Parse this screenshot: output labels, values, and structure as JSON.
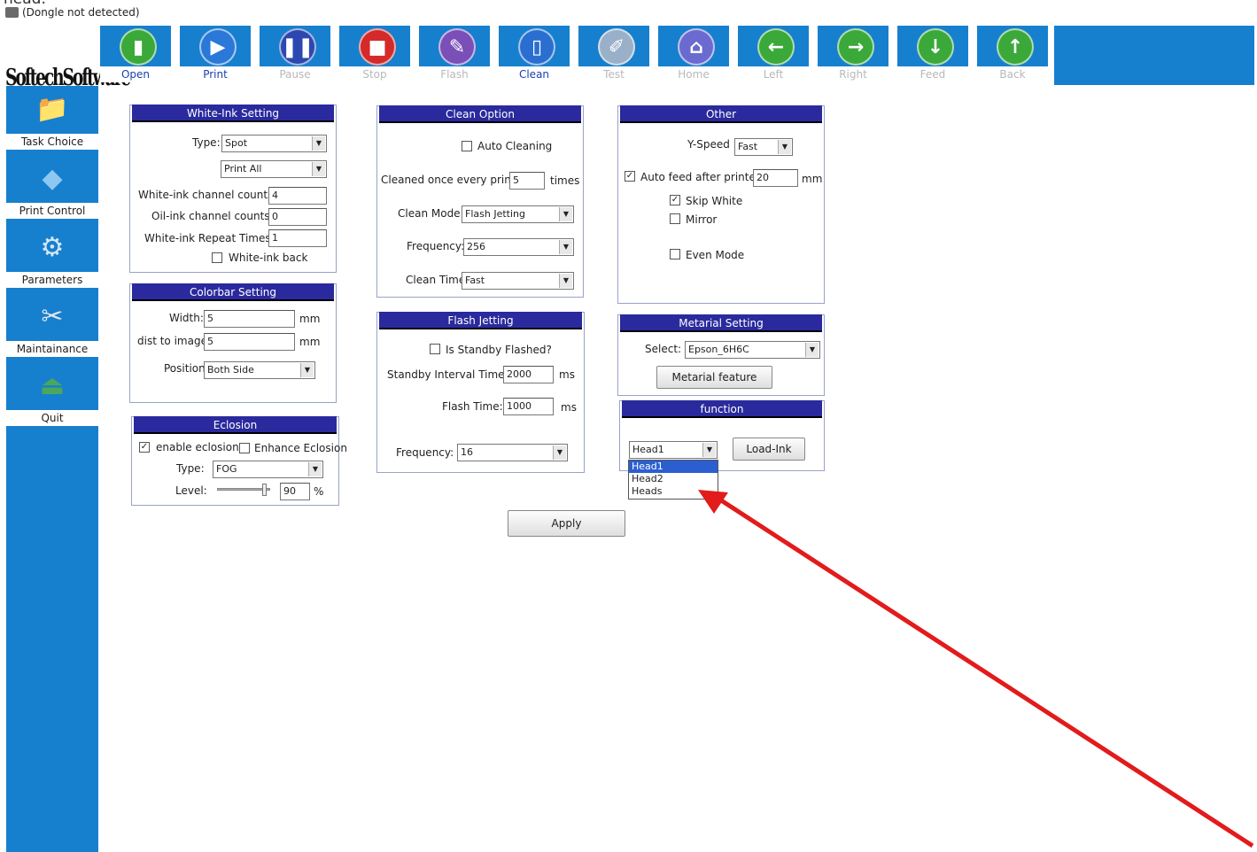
{
  "clipped_text": "nead.",
  "window_title": "(Dongle not detected)",
  "logo_text": "SoftechSoftware",
  "toolbar": {
    "buttons": [
      {
        "label": "Open",
        "icon": "open-icon",
        "color": "#3aa93a",
        "state": "active"
      },
      {
        "label": "Print",
        "icon": "play-icon",
        "color": "#2a78d8",
        "state": "active"
      },
      {
        "label": "Pause",
        "icon": "pause-icon",
        "color": "#2c48b0",
        "state": "disabled"
      },
      {
        "label": "Stop",
        "icon": "stop-icon",
        "color": "#d42a2a",
        "state": "disabled"
      },
      {
        "label": "Flash",
        "icon": "flash-icon",
        "color": "#7a4fb8",
        "state": "disabled"
      },
      {
        "label": "Clean",
        "icon": "clean-bottle-icon",
        "color": "#2a6fd0",
        "state": "active"
      },
      {
        "label": "Test",
        "icon": "test-icon",
        "color": "#9ab0c8",
        "state": "disabled"
      },
      {
        "label": "Home",
        "icon": "home-icon",
        "color": "#6a6ad0",
        "state": "disabled"
      },
      {
        "label": "Left",
        "icon": "arrow-left-icon",
        "color": "#3aa93a",
        "state": "disabled"
      },
      {
        "label": "Right",
        "icon": "arrow-right-icon",
        "color": "#3aa93a",
        "state": "disabled"
      },
      {
        "label": "Feed",
        "icon": "arrow-down-icon",
        "color": "#3aa93a",
        "state": "disabled"
      },
      {
        "label": "Back",
        "icon": "arrow-up-icon",
        "color": "#3aa93a",
        "state": "disabled"
      }
    ]
  },
  "sidebar": {
    "items": [
      {
        "label": "Task Choice",
        "icon": "folder-icon"
      },
      {
        "label": "Print Control",
        "icon": "print-control-icon"
      },
      {
        "label": "Parameters",
        "icon": "gear-icon"
      },
      {
        "label": "Maintainance",
        "icon": "tools-icon"
      },
      {
        "label": "Quit",
        "icon": "quit-icon"
      }
    ]
  },
  "white_ink": {
    "title": "White-Ink Setting",
    "type_label": "Type:",
    "type_value": "Spot",
    "mode_value": "Print All",
    "white_channel_label": "White-ink channel counts:",
    "white_channel_value": "4",
    "oil_channel_label": "Oil-ink channel counts:",
    "oil_channel_value": "0",
    "repeat_label": "White-ink Repeat Times:",
    "repeat_value": "1",
    "back_label": "White-ink back",
    "back_checked": false
  },
  "colorbar": {
    "title": "Colorbar Setting",
    "width_label": "Width:",
    "width_value": "5",
    "width_unit": "mm",
    "dist_label": "dist to image:",
    "dist_value": "5",
    "dist_unit": "mm",
    "position_label": "Position",
    "position_value": "Both Side"
  },
  "eclosion": {
    "title": "Eclosion",
    "enable_label": "enable eclosion",
    "enable_checked": true,
    "enhance_label": "Enhance Eclosion",
    "enhance_checked": false,
    "type_label": "Type:",
    "type_value": "FOG",
    "level_label": "Level:",
    "level_value": "90",
    "level_unit": "%",
    "level_fraction": 0.9
  },
  "clean": {
    "title": "Clean Option",
    "auto_label": "Auto Cleaning",
    "auto_checked": false,
    "every_label": "Cleaned once every print:",
    "every_value": "5",
    "every_unit": "times",
    "mode_label": "Clean Mode:",
    "mode_value": "Flash Jetting",
    "freq_label": "Frequency:",
    "freq_value": "256",
    "time_label": "Clean Time:",
    "time_value": "Fast"
  },
  "flash": {
    "title": "Flash Jetting",
    "standby_label": "Is Standby Flashed?",
    "standby_checked": false,
    "interval_label": "Standby Interval Time:",
    "interval_value": "2000",
    "interval_unit": "ms",
    "time_label": "Flash Time:",
    "time_value": "1000",
    "time_unit": "ms",
    "freq_label": "Frequency:",
    "freq_value": "16"
  },
  "other": {
    "title": "Other",
    "yspeed_label": "Y-Speed",
    "yspeed_value": "Fast",
    "autofeed_label": "Auto feed after printed:",
    "autofeed_checked": true,
    "autofeed_value": "20",
    "autofeed_unit": "mm",
    "skip_label": "Skip White",
    "skip_checked": true,
    "mirror_label": "Mirror",
    "mirror_checked": false,
    "even_label": "Even Mode",
    "even_checked": false
  },
  "material": {
    "title": "Metarial Setting",
    "select_label": "Select:",
    "select_value": "Epson_6H6C",
    "feature_button": "Metarial feature"
  },
  "function": {
    "title": "function",
    "head_value": "Head1",
    "load_button": "Load-Ink",
    "options": [
      "Head1",
      "Head2",
      "Heads"
    ],
    "highlighted": "Head1"
  },
  "apply_button": "Apply",
  "annotation_arrow_color": "#e21b1b"
}
